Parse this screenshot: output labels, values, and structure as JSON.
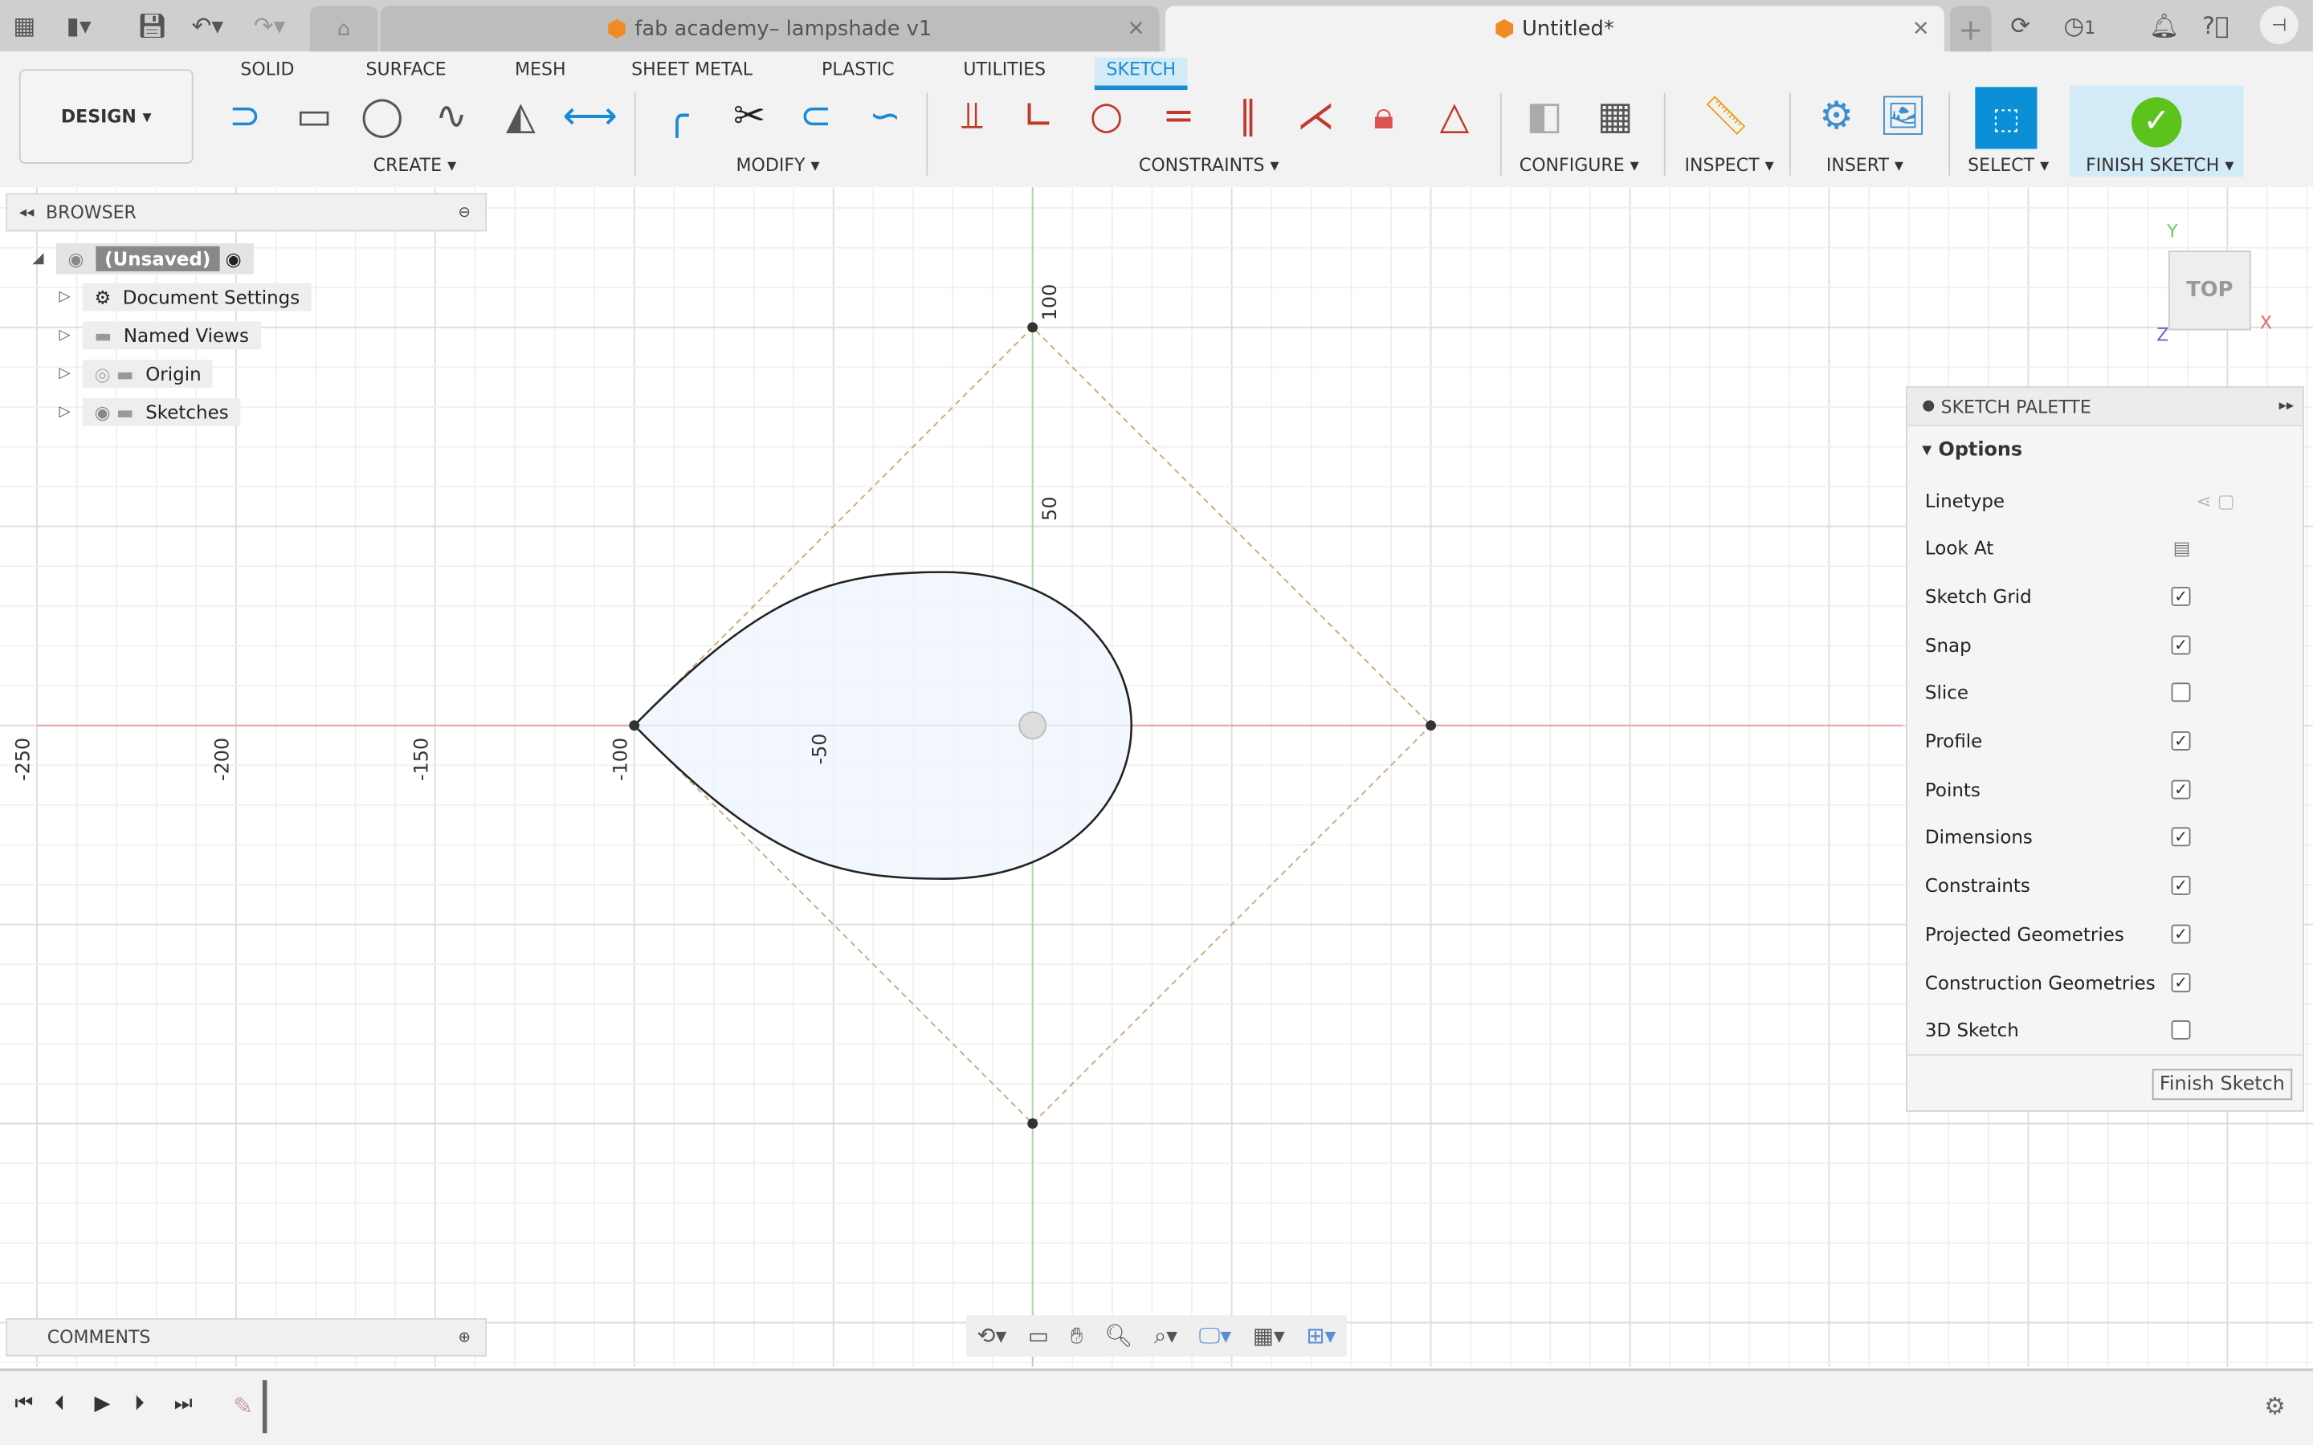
{
  "tabs": [
    {
      "label": "fab academy– lampshade v1",
      "active": false
    },
    {
      "label": "Untitled*",
      "active": true
    }
  ],
  "top_right": {
    "jobs_count": "1"
  },
  "ribbon": {
    "workspace": "DESIGN ▾",
    "tabs": [
      "SOLID",
      "SURFACE",
      "MESH",
      "SHEET METAL",
      "PLASTIC",
      "UTILITIES",
      "SKETCH"
    ],
    "active_tab": "SKETCH",
    "groups": {
      "create": "CREATE ▾",
      "modify": "MODIFY ▾",
      "constraints": "CONSTRAINTS ▾",
      "configure": "CONFIGURE ▾",
      "inspect": "INSPECT ▾",
      "insert": "INSERT ▾",
      "select": "SELECT ▾",
      "finish": "FINISH SKETCH ▾"
    }
  },
  "browser": {
    "title": "BROWSER",
    "items": [
      {
        "label": "(Unsaved)"
      },
      {
        "label": "Document Settings"
      },
      {
        "label": "Named Views"
      },
      {
        "label": "Origin"
      },
      {
        "label": "Sketches"
      }
    ]
  },
  "comments": {
    "title": "COMMENTS"
  },
  "viewcube": {
    "face": "TOP",
    "axes": [
      "Y",
      "X",
      "Z"
    ]
  },
  "sketch_axis_labels": {
    "x": [
      "-250",
      "-200",
      "-150",
      "-100",
      "-50"
    ],
    "y": [
      "100",
      "50"
    ]
  },
  "palette": {
    "title": "SKETCH PALETTE",
    "section": "Options",
    "rows": [
      {
        "label": "Linetype",
        "type": "icons"
      },
      {
        "label": "Look At",
        "type": "icon"
      },
      {
        "label": "Sketch Grid",
        "checked": true
      },
      {
        "label": "Snap",
        "checked": true
      },
      {
        "label": "Slice",
        "checked": false
      },
      {
        "label": "Profile",
        "checked": true
      },
      {
        "label": "Points",
        "checked": true
      },
      {
        "label": "Dimensions",
        "checked": true
      },
      {
        "label": "Constraints",
        "checked": true
      },
      {
        "label": "Projected Geometries",
        "checked": true
      },
      {
        "label": "Construction Geometries",
        "checked": true
      },
      {
        "label": "3D Sketch",
        "checked": false
      }
    ],
    "finish_button": "Finish Sketch"
  },
  "colors": {
    "accent": "#1a8ad4",
    "finish_green": "#5cc21c",
    "constraint_red": "#c0392b",
    "x_axis": "#e8a0a0",
    "y_axis": "#a6d8a6"
  }
}
